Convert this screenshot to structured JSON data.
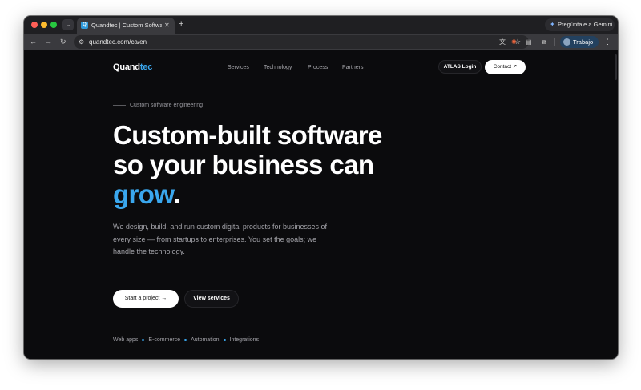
{
  "browser": {
    "tab": {
      "title": "Quandtec | Custom Software",
      "close_glyph": "✕",
      "favicon_glyph": "Q"
    },
    "new_tab_glyph": "+",
    "tab_search_glyph": "⌄",
    "gemini": {
      "icon_glyph": "✦",
      "label": "Pregúntale a Gemini"
    },
    "nav": {
      "back_glyph": "←",
      "forward_glyph": "→",
      "reload_glyph": "↻"
    },
    "omnibox": {
      "site_info_glyph": "⚙",
      "url": "quandtec.com/ca/en",
      "translate_glyph": "文",
      "star_glyph": "☆"
    },
    "extensions": [
      {
        "glyph": "✺"
      },
      {
        "glyph": "▤"
      },
      {
        "glyph": "⧉"
      }
    ],
    "profile": {
      "label": "Trabajo"
    },
    "menu_glyph": "⋮"
  },
  "site": {
    "logo": {
      "main": "Quand",
      "accent": "tec"
    },
    "nav": {
      "items": [
        "Services",
        "Technology",
        "Process",
        "Partners"
      ]
    },
    "atlas_login": "ATLAS Login",
    "contact": "Contact ↗"
  },
  "hero": {
    "eyebrow": "Custom software engineering",
    "headline": {
      "line1": "Custom-built software",
      "line2": "so your business can",
      "accent": "grow",
      "end": "."
    },
    "lead": "We design, build, and run custom digital products for businesses of every size — from startups to enterprises. You set the goals; we handle the technology.",
    "cta_primary": "Start a project →",
    "cta_secondary": "View services",
    "tags": [
      "Web apps",
      "E-commerce",
      "Automation",
      "Integrations"
    ]
  },
  "colors": {
    "accent": "#3aa7ee",
    "background": "#0b0b0d",
    "text": "#ffffff",
    "muted": "#a3a3a9"
  }
}
